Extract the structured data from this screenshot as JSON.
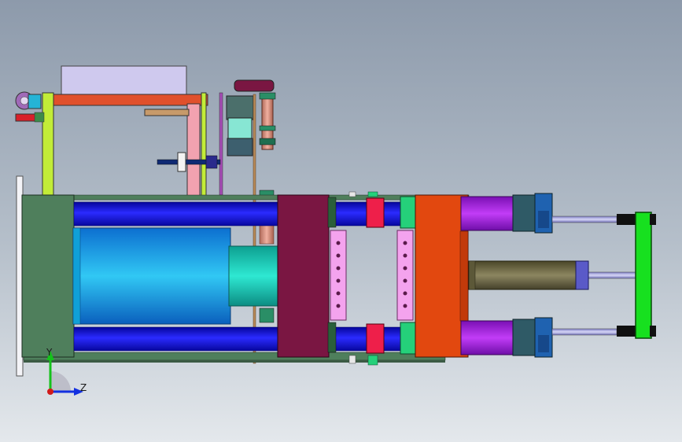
{
  "viewport": {
    "background_top": "#8d9aab",
    "background_bottom": "#e4e8ec"
  },
  "triad": {
    "y_label": "Y",
    "z_label": "Z",
    "y_color": "#15c21b",
    "z_color": "#1330e0",
    "origin_color": "#d11a1a"
  },
  "colors": {
    "tie_bar": "#1010ee",
    "rear_plate": "#4f7f5c",
    "moving_platen": "#7a1642",
    "fixed_platen": "#e2480f",
    "clamp_cylinder": "#19b5ef",
    "cylinder_cap": "#21c9b6",
    "ejector_plate": "#f4a3ee",
    "hydraulic_cylinder": "#a21ee0",
    "cylinder_nut": "#2f5a66",
    "end_plate": "#17e01f",
    "nozzle_barrel": "#6e6a44",
    "frame_yellow": "#c2ec38",
    "frame_top_bar": "#e0502c",
    "frame_pink": "#f2a2b0",
    "motor_body": "#87e6d3",
    "spacer_red": "#ee1f4a",
    "spacer_green": "#25d07a",
    "hood_box": "#cfc9ee"
  }
}
